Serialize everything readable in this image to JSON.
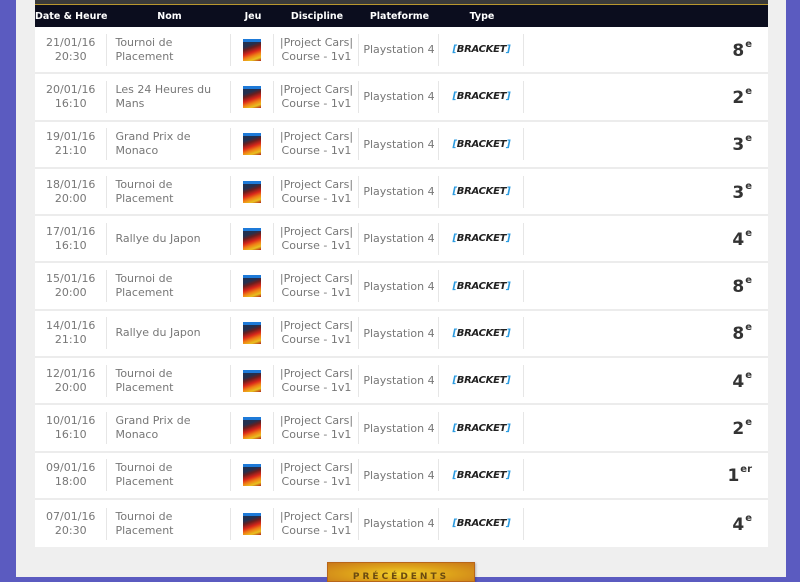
{
  "table": {
    "headers": {
      "date": "Date & Heure",
      "name": "Nom",
      "game": "Jeu",
      "discipline": "Discipline",
      "platform": "Plateforme",
      "type": "Type",
      "rank": ""
    },
    "rows": [
      {
        "date": "21/01/16",
        "time": "20:30",
        "name": "Tournoi de Placement",
        "game_icon": "project-cars-cover",
        "discipline_line1": "|Project Cars|",
        "discipline_line2": "Course - 1v1",
        "platform": "Playstation 4",
        "type": "BRACKET",
        "rank": "8",
        "rank_suffix": "e"
      },
      {
        "date": "20/01/16",
        "time": "16:10",
        "name": "Les 24 Heures du Mans",
        "game_icon": "project-cars-cover",
        "discipline_line1": "|Project Cars|",
        "discipline_line2": "Course - 1v1",
        "platform": "Playstation 4",
        "type": "BRACKET",
        "rank": "2",
        "rank_suffix": "e"
      },
      {
        "date": "19/01/16",
        "time": "21:10",
        "name": "Grand Prix de Monaco",
        "game_icon": "project-cars-cover",
        "discipline_line1": "|Project Cars|",
        "discipline_line2": "Course - 1v1",
        "platform": "Playstation 4",
        "type": "BRACKET",
        "rank": "3",
        "rank_suffix": "e"
      },
      {
        "date": "18/01/16",
        "time": "20:00",
        "name": "Tournoi de Placement",
        "game_icon": "project-cars-cover",
        "discipline_line1": "|Project Cars|",
        "discipline_line2": "Course - 1v1",
        "platform": "Playstation 4",
        "type": "BRACKET",
        "rank": "3",
        "rank_suffix": "e"
      },
      {
        "date": "17/01/16",
        "time": "16:10",
        "name": "Rallye du Japon",
        "game_icon": "project-cars-cover",
        "discipline_line1": "|Project Cars|",
        "discipline_line2": "Course - 1v1",
        "platform": "Playstation 4",
        "type": "BRACKET",
        "rank": "4",
        "rank_suffix": "e"
      },
      {
        "date": "15/01/16",
        "time": "20:00",
        "name": "Tournoi de Placement",
        "game_icon": "project-cars-cover",
        "discipline_line1": "|Project Cars|",
        "discipline_line2": "Course - 1v1",
        "platform": "Playstation 4",
        "type": "BRACKET",
        "rank": "8",
        "rank_suffix": "e"
      },
      {
        "date": "14/01/16",
        "time": "21:10",
        "name": "Rallye du Japon",
        "game_icon": "project-cars-cover",
        "discipline_line1": "|Project Cars|",
        "discipline_line2": "Course - 1v1",
        "platform": "Playstation 4",
        "type": "BRACKET",
        "rank": "8",
        "rank_suffix": "e"
      },
      {
        "date": "12/01/16",
        "time": "20:00",
        "name": "Tournoi de Placement",
        "game_icon": "project-cars-cover",
        "discipline_line1": "|Project Cars|",
        "discipline_line2": "Course - 1v1",
        "platform": "Playstation 4",
        "type": "BRACKET",
        "rank": "4",
        "rank_suffix": "e"
      },
      {
        "date": "10/01/16",
        "time": "16:10",
        "name": "Grand Prix de Monaco",
        "game_icon": "project-cars-cover",
        "discipline_line1": "|Project Cars|",
        "discipline_line2": "Course - 1v1",
        "platform": "Playstation 4",
        "type": "BRACKET",
        "rank": "2",
        "rank_suffix": "e"
      },
      {
        "date": "09/01/16",
        "time": "18:00",
        "name": "Tournoi de Placement",
        "game_icon": "project-cars-cover",
        "discipline_line1": "|Project Cars|",
        "discipline_line2": "Course - 1v1",
        "platform": "Playstation 4",
        "type": "BRACKET",
        "rank": "1",
        "rank_suffix": "er"
      },
      {
        "date": "07/01/16",
        "time": "20:30",
        "name": "Tournoi de Placement",
        "game_icon": "project-cars-cover",
        "discipline_line1": "|Project Cars|",
        "discipline_line2": "Course - 1v1",
        "platform": "Playstation 4",
        "type": "BRACKET",
        "rank": "4",
        "rank_suffix": "e"
      }
    ]
  },
  "more_button": {
    "label": "PRÉCÉDENTS"
  },
  "colors": {
    "page_background": "#5b5bc0",
    "header_background": "#0b0d1e",
    "bracket_accent": "#2c9be0",
    "button_gold": "#dda11a"
  }
}
